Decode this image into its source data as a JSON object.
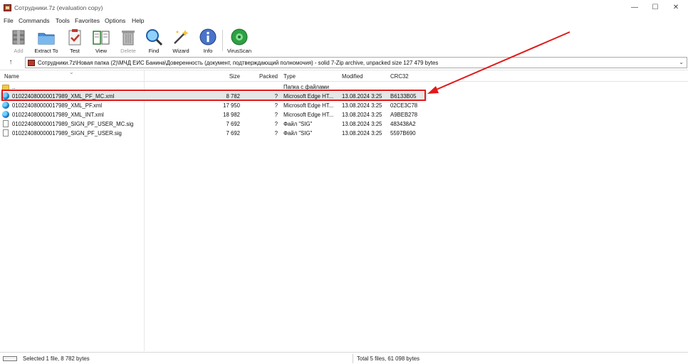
{
  "window": {
    "title": "Сотрудники.7z (evaluation copy)",
    "minimize": "—",
    "maximize": "☐",
    "close": "✕"
  },
  "menu": [
    "File",
    "Commands",
    "Tools",
    "Favorites",
    "Options",
    "Help"
  ],
  "toolbar": {
    "add": "Add",
    "extract_to": "Extract To",
    "test": "Test",
    "view": "View",
    "delete": "Delete",
    "find": "Find",
    "wizard": "Wizard",
    "info": "Info",
    "virusscan": "VirusScan"
  },
  "address": {
    "up": "↑",
    "path": "Сотрудники.7z\\Новая папка (2)\\МЧД ЕИС Банина\\Доверенность (документ, подтверждающий полномочия) - solid 7-Zip archive, unpacked size 127 479 bytes",
    "dropdown": "⌄"
  },
  "columns": {
    "name": "Name",
    "size": "Size",
    "packed": "Packed",
    "type": "Type",
    "modified": "Modified",
    "crc": "CRC32",
    "sort_indicator": "⌄"
  },
  "files": [
    {
      "name": "..",
      "size": "",
      "packed": "",
      "type": "Папка с файлами",
      "modified": "",
      "crc": "",
      "icon": "folder-icon"
    },
    {
      "name": "010224080000017989_XML_PF_MC.xml",
      "size": "8 782",
      "packed": "?",
      "type": "Microsoft Edge HT...",
      "modified": "13.08.2024 3:25",
      "crc": "B6133B05",
      "icon": "edge-icon",
      "selected": true
    },
    {
      "name": "010224080000017989_XML_PF.xml",
      "size": "17 950",
      "packed": "?",
      "type": "Microsoft Edge HT...",
      "modified": "13.08.2024 3:25",
      "crc": "02CE3C78",
      "icon": "edge-icon"
    },
    {
      "name": "010224080000017989_XML_INT.xml",
      "size": "18 982",
      "packed": "?",
      "type": "Microsoft Edge HT...",
      "modified": "13.08.2024 3:25",
      "crc": "A9BEB278",
      "icon": "edge-icon"
    },
    {
      "name": "010224080000017989_SIGN_PF_USER_MC.sig",
      "size": "7 692",
      "packed": "?",
      "type": "Файл \"SIG\"",
      "modified": "13.08.2024 3:25",
      "crc": "483438A2",
      "icon": "doc-icon"
    },
    {
      "name": "010224080000017989_SIGN_PF_USER.sig",
      "size": "7 692",
      "packed": "?",
      "type": "Файл \"SIG\"",
      "modified": "13.08.2024 3:25",
      "crc": "5597B690",
      "icon": "doc-icon"
    }
  ],
  "status": {
    "selection": "Selected 1 file, 8 782 bytes",
    "total": "Total 5 files, 61 098 bytes"
  },
  "colors": {
    "annotation": "#e01a1a",
    "selected_row": "#e6e6e6"
  }
}
